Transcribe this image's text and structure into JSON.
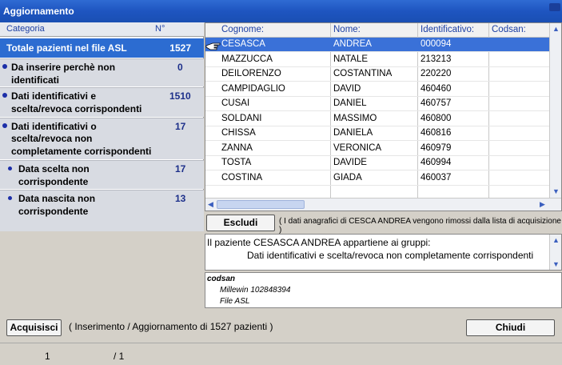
{
  "window": {
    "title": "Aggiornamento"
  },
  "categories": {
    "header": {
      "category_label": "Categoria",
      "count_label": "N°"
    },
    "total": {
      "label": "Totale pazienti nel file ASL",
      "count": "1527"
    },
    "items": [
      {
        "line1": "Da inserire perchè non",
        "line2": "identificati",
        "line3": "",
        "count": "0"
      },
      {
        "line1": "Dati identificativi e",
        "line2": "scelta/revoca corrispondenti",
        "line3": "",
        "count": "1510"
      },
      {
        "line1": "Dati identificativi o",
        "line2": "scelta/revoca non",
        "line3": "completamente corrispondenti",
        "count": "17"
      },
      {
        "line1": "Data scelta non",
        "line2": "corrispondente",
        "line3": "",
        "count": "17"
      },
      {
        "line1": "Data nascita non",
        "line2": "corrispondente",
        "line3": "",
        "count": "13"
      }
    ]
  },
  "table": {
    "columns": [
      "Cognome:",
      "Nome:",
      "Identificativo:",
      "Codsan:"
    ],
    "rows": [
      {
        "cognome": "CESASCA",
        "nome": "ANDREA",
        "id": "000094",
        "codsan": ""
      },
      {
        "cognome": "MAZZUCCA",
        "nome": "NATALE",
        "id": "213213",
        "codsan": ""
      },
      {
        "cognome": "DEILORENZO",
        "nome": "COSTANTINA",
        "id": "220220",
        "codsan": ""
      },
      {
        "cognome": "CAMPIDAGLIO",
        "nome": "DAVID",
        "id": "460460",
        "codsan": ""
      },
      {
        "cognome": "CUSAI",
        "nome": "DANIEL",
        "id": "460757",
        "codsan": ""
      },
      {
        "cognome": "SOLDANI",
        "nome": "MASSIMO",
        "id": "460800",
        "codsan": ""
      },
      {
        "cognome": "CHISSA",
        "nome": "DANIELA",
        "id": "460816",
        "codsan": ""
      },
      {
        "cognome": "ZANNA",
        "nome": "VERONICA",
        "id": "460979",
        "codsan": ""
      },
      {
        "cognome": "TOSTA",
        "nome": "DAVIDE",
        "id": "460994",
        "codsan": ""
      },
      {
        "cognome": "COSTINA",
        "nome": "GIADA",
        "id": "460037",
        "codsan": ""
      }
    ]
  },
  "escludi": {
    "button_label": "Escludi",
    "note": "( I dati anagrafici di CESCA ANDREA vengono rimossi dalla lista di acquisizione )"
  },
  "groups_info": {
    "line1": "Il paziente CESASCA  ANDREA appartiene ai gruppi:",
    "line2": "Dati identificativi e scelta/revoca non completamente corrispondenti"
  },
  "codsan_info": {
    "heading": "codsan",
    "line1": "Millewin 102848394",
    "line2": "File ASL"
  },
  "footer": {
    "acquisisci_label": "Acquisisci",
    "acquisisci_note": "( Inserimento / Aggiornamento di 1527 pazienti )",
    "chiudi_label": "Chiudi",
    "page_current": "1",
    "page_total": "/  1"
  },
  "colors": {
    "selection": "#3a71d8",
    "title_bar": "#1e55c0",
    "header_text": "#1c3fa3"
  }
}
